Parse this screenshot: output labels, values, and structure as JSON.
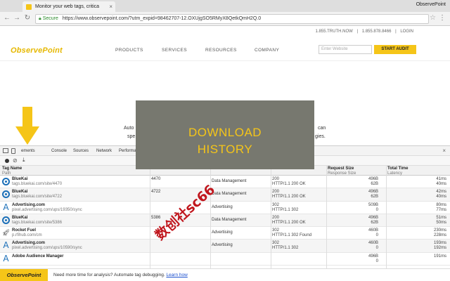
{
  "browser": {
    "tab_title": "Monitor your web tags, critica",
    "profile": "ObservePoint",
    "secure_label": "Secure",
    "url": "https://www.observepoint.com/?utm_expid=98462707-12.OXUjgSO5RMyX8QetkQmH2Q.0"
  },
  "site": {
    "phone1": "1.855.TRUTH.NOW",
    "phone2": "1.855.878.8466",
    "login": "LOGIN",
    "logo": "ObservePoint",
    "nav": [
      "PRODUCTS",
      "SERVICES",
      "RESOURCES",
      "COMPANY"
    ],
    "search_placeholder": "Enter Website",
    "audit_button": "START AUDIT",
    "blurb_left": "Auto",
    "blurb_left2": "spe",
    "blurb_right": "can",
    "blurb_right2": "gies."
  },
  "overlay": {
    "line1": "DOWNLOAD",
    "line2": "HISTORY"
  },
  "devtools": {
    "tabs": [
      "ements",
      "Console",
      "Sources",
      "Network",
      "Performa"
    ],
    "columns": {
      "tag_name": "Tag Name",
      "path": "Path",
      "request_size": "Request Size",
      "response_size": "Response Size",
      "total_time": "Total Time",
      "latency": "Latency"
    },
    "rows": [
      {
        "name": "BlueKai",
        "path": "tags.bluekai.com/site/4470",
        "account": "4470",
        "category": "Data Management",
        "status1": "200",
        "status2": "HTTP/1.1 200 OK",
        "req": "496B",
        "resp": "62B",
        "time": "41ms",
        "lat": "40ms",
        "icon": "bluekai",
        "bar": "#2a9d48"
      },
      {
        "name": "BlueKai",
        "path": "tags.bluekai.com/site/4722",
        "account": "4722",
        "category": "Data Management",
        "status1": "200",
        "status2": "HTTP/1.1 200 OK",
        "req": "496B",
        "resp": "62B",
        "time": "42ms",
        "lat": "40ms",
        "icon": "bluekai",
        "bar": "#2a9d48"
      },
      {
        "name": "Advertising.com",
        "path": "pixel.advertising.com/ups/19350/sync",
        "account": "",
        "category": "Advertising",
        "status1": "302",
        "status2": "HTTP/1.1 302",
        "req": "509B",
        "resp": "0",
        "time": "80ms",
        "lat": "77ms",
        "icon": "advertising",
        "bar": "#2a9d48"
      },
      {
        "name": "BlueKai",
        "path": "tags.bluekai.com/site/5386",
        "account": "5386",
        "category": "Data Management",
        "status1": "200",
        "status2": "HTTP/1.1 200 OK",
        "req": "496B",
        "resp": "62B",
        "time": "51ms",
        "lat": "50ms",
        "icon": "bluekai",
        "bar": "#2a9d48"
      },
      {
        "name": "Rocket Fuel",
        "path": "p.rfihub.com/cm",
        "account": "",
        "category": "Advertising",
        "status1": "302",
        "status2": "HTTP/1.1 302 Found",
        "req": "460B",
        "resp": "0",
        "time": "230ms",
        "lat": "228ms",
        "icon": "rocket",
        "bar": "#2a9d48"
      },
      {
        "name": "Advertising.com",
        "path": "pixel.advertising.com/ups/10590/sync",
        "account": "",
        "category": "Advertising",
        "status1": "302",
        "status2": "HTTP/1.1 302",
        "req": "460B",
        "resp": "0",
        "time": "193ms",
        "lat": "192ms",
        "icon": "advertising",
        "bar": "#2a9d48"
      },
      {
        "name": "Adobe Audience Manager",
        "path": "",
        "account": "",
        "category": "",
        "status1": "",
        "status2": "",
        "req": "496B",
        "resp": "0",
        "time": "191ms",
        "lat": "",
        "icon": "advertising",
        "bar": "#d9342b"
      }
    ]
  },
  "footer": {
    "logo": "ObservePoint",
    "text": "Need more time for analysis? Automate tag debugging.",
    "link": "Learn how"
  },
  "watermark": "数创社sc66",
  "colors": {
    "brand_yellow": "#f5c518",
    "overlay_bg": "#77786f",
    "link_blue": "#1a4fcf"
  }
}
